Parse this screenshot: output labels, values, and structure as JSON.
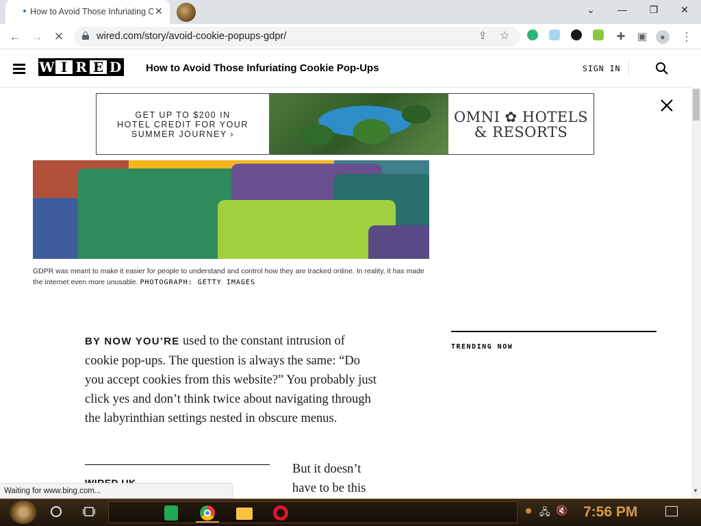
{
  "browser": {
    "tab_title": "How to Avoid Those Infuriating Cookie Pop-Ups",
    "tab_close": "✕",
    "url": "wired.com/story/avoid-cookie-popups-gdpr/",
    "window_controls": {
      "minimize": "—",
      "restore": "❐",
      "close": "✕",
      "tab_list": "⌄"
    },
    "status_text": "Waiting for www.bing.com..."
  },
  "site": {
    "logo_letters": [
      "W",
      "I",
      "R",
      "E",
      "D"
    ],
    "header_title": "How to Avoid Those Infuriating Cookie Pop-Ups",
    "signin_label": "SIGN IN"
  },
  "ad": {
    "copy_line1": "GET UP TO $200 IN",
    "copy_line2": "HOTEL CREDIT FOR YOUR",
    "copy_line3": "SUMMER JOURNEY ›",
    "brand_line1": "OMNI ✿ HOTELS",
    "brand_line2": "& RESORTS"
  },
  "hero": {
    "caption": "GDPR was meant to make it easier for people to understand and control how they are tracked online. In reality, it has made the internet even more unusable.",
    "credit": "PHOTOGRAPH: GETTY IMAGES"
  },
  "article": {
    "lede_caps": "BY NOW YOU’RE",
    "lede_rest": " used to the constant intrusion of cookie pop-ups. The question is always the same: “Do you accept cookies from this website?” You probably just click yes and don’t think twice about navigating through the labyrinthian settings nested in obscure menus.",
    "continuation": "But it doesn’t have to be this",
    "related_label": "WIRED UK"
  },
  "sidebar": {
    "trending_label": "TRENDING NOW"
  },
  "taskbar": {
    "clock": "7:56 PM"
  },
  "colors": {
    "accent_clock": "#d59a4a",
    "chrome_tabstrip": "#dee1e6",
    "ad_pool": "#2d8ec9"
  }
}
